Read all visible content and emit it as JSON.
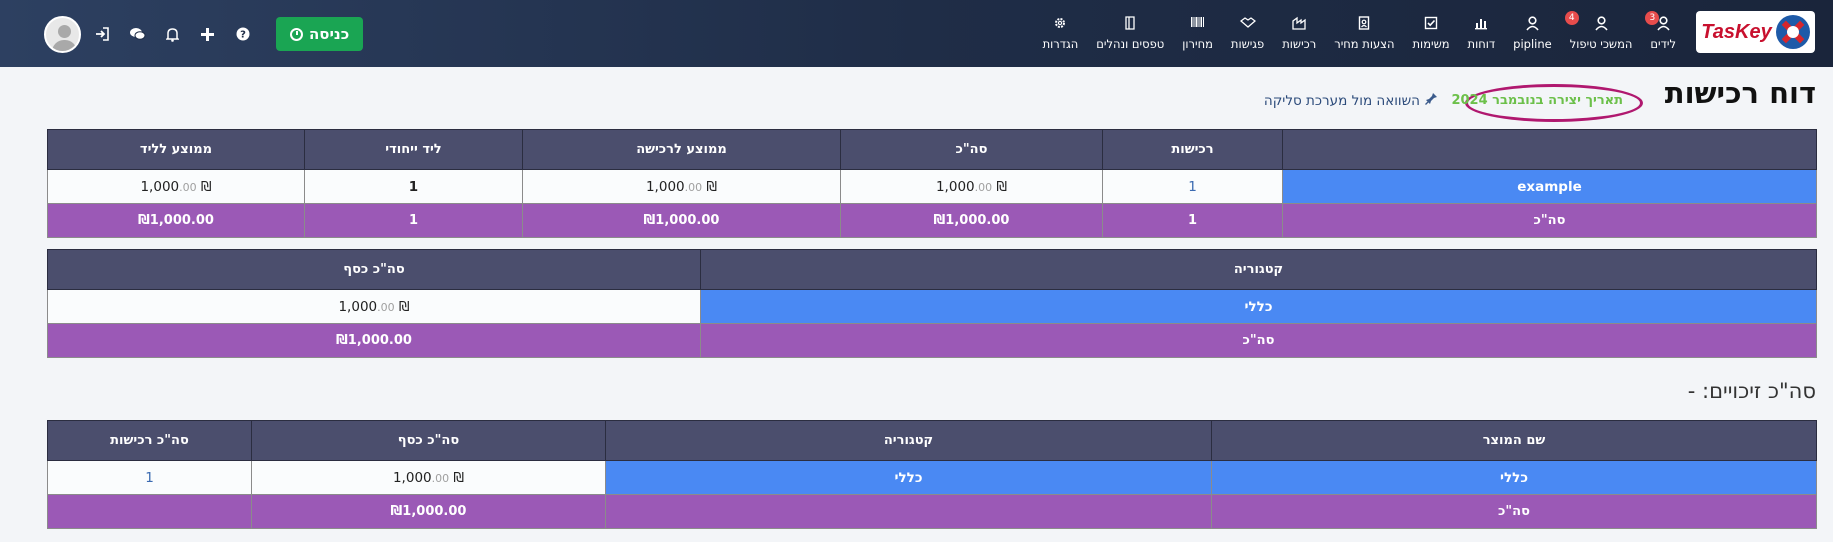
{
  "nav": {
    "logo_text": "TasKey",
    "items": [
      {
        "label": "לידים",
        "icon": "person-icon",
        "badge": "3"
      },
      {
        "label": "המשכי טיפול",
        "icon": "person-icon",
        "badge": "4"
      },
      {
        "label": "pipline",
        "icon": "person-icon",
        "badge": ""
      },
      {
        "label": "דוחות",
        "icon": "chart-icon",
        "badge": ""
      },
      {
        "label": "משימות",
        "icon": "checkbox-icon",
        "badge": ""
      },
      {
        "label": "הצעות מחיר",
        "icon": "document-icon",
        "badge": ""
      },
      {
        "label": "רכישות",
        "icon": "purchase-icon",
        "badge": ""
      },
      {
        "label": "פגישות",
        "icon": "handshake-icon",
        "badge": ""
      },
      {
        "label": "מחירון",
        "icon": "barcode-icon",
        "badge": ""
      },
      {
        "label": "טפסים ונהלים",
        "icon": "book-icon",
        "badge": ""
      },
      {
        "label": "הגדרות",
        "icon": "gear-icon",
        "badge": ""
      }
    ],
    "enter_button": "כניסה"
  },
  "page": {
    "title": "דוח רכישות",
    "date_label": "תאריך יצירה בנובמבר 2024",
    "compare_label": "השוואה מול מערכת סליקה"
  },
  "summary_table": {
    "headers": [
      "",
      "רכישות",
      "סה\"כ",
      "ממוצע לרכישה",
      "ליד ייחודי",
      "ממוצע לליד"
    ],
    "row": {
      "name": "example",
      "purchases": "1",
      "total": "1,000",
      "total_cents": ".00",
      "avg_purchase": "1,000",
      "avg_purchase_cents": ".00",
      "unique_lead": "1",
      "avg_lead": "1,000",
      "avg_lead_cents": ".00"
    },
    "total_row": {
      "label": "סה\"כ",
      "purchases": "1",
      "total": "₪1,000.00",
      "avg_purchase": "₪1,000.00",
      "unique_lead": "1",
      "avg_lead": "₪1,000.00"
    }
  },
  "category_table": {
    "headers": [
      "קטגוריה",
      "סה\"כ כסף"
    ],
    "row": {
      "category": "כללי",
      "money": "1,000",
      "money_cents": ".00"
    },
    "total_row": {
      "label": "סה\"כ",
      "money": "₪1,000.00"
    }
  },
  "credits_label": "סה\"כ זיכויים: -",
  "product_table": {
    "headers": [
      "שם המוצר",
      "קטגוריה",
      "סה\"כ כסף",
      "סה\"כ רכישות"
    ],
    "row": {
      "product": "כללי",
      "category": "כללי",
      "money": "1,000",
      "money_cents": ".00",
      "purchases": "1"
    },
    "total_row": {
      "label": "סה\"כ",
      "category": "",
      "money": "₪1,000.00",
      "purchases": ""
    }
  },
  "currency_symbol": "₪",
  "colors": {
    "header_bg": "#4b4e6d",
    "blue_cell": "#4a89f3",
    "total_row": "#9b59b6",
    "enter_button": "#1aa553"
  }
}
